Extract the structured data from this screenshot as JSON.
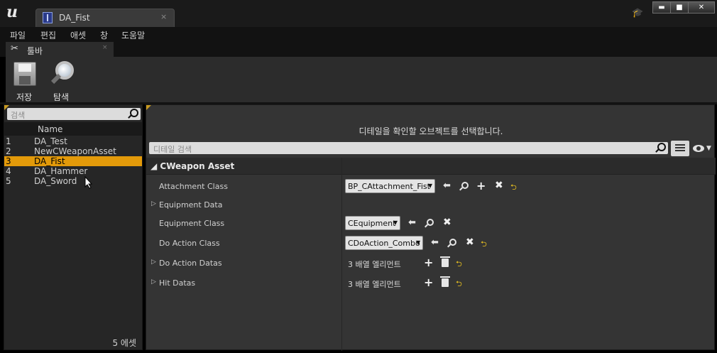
{
  "window": {
    "tab_title": "DA_Fist",
    "tab_close": "×",
    "min_label": "▬",
    "max_label": "■",
    "close_label": "✕"
  },
  "menu": [
    "파일",
    "편집",
    "애셋",
    "창",
    "도움말"
  ],
  "toolbar_tab": {
    "label": "툴바",
    "close": "×"
  },
  "toolbar": {
    "save": "저장",
    "browse": "탐색"
  },
  "asset_list": {
    "search_placeholder": "검색",
    "column_name": "Name",
    "items": [
      {
        "index": "1",
        "name": "DA_Test"
      },
      {
        "index": "2",
        "name": "NewCWeaponAsset"
      },
      {
        "index": "3",
        "name": "DA_Fist",
        "selected": true
      },
      {
        "index": "4",
        "name": "DA_Hammer"
      },
      {
        "index": "5",
        "name": "DA_Sword"
      }
    ],
    "footer": "5 에셋"
  },
  "details": {
    "hint": "디테일을 확인할 오브젝트를 선택합니다.",
    "search_placeholder": "디테일 검색",
    "category": "CWeapon Asset",
    "properties": {
      "attachment_class": {
        "label": "Attachment Class",
        "value": "BP_CAttachment_Fist"
      },
      "equipment_data": {
        "label": "Equipment Data"
      },
      "equipment_class": {
        "label": "Equipment Class",
        "value": "CEquipment"
      },
      "do_action_class": {
        "label": "Do Action Class",
        "value": "CDoAction_Combo"
      },
      "do_action_datas": {
        "label": "Do Action Datas",
        "value": "3 배열 엘리먼트"
      },
      "hit_datas": {
        "label": "Hit Datas",
        "value": "3 배열 엘리먼트"
      }
    }
  },
  "colors": {
    "accent_selection": "#e39a0a",
    "reset_arrow": "#e8c020"
  }
}
